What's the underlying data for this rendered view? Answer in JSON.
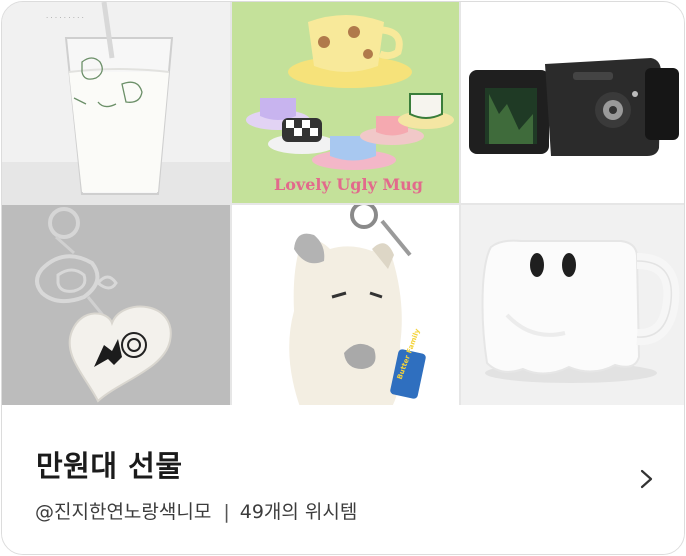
{
  "collection": {
    "title": "만원대 선물",
    "author": "@진지한연노랑색니모",
    "separator": "|",
    "count_text": "49개의 위시템"
  },
  "tiles": [
    {
      "subject": "glass-cup",
      "printed_text": ""
    },
    {
      "subject": "painted-mugs",
      "printed_text": "Lovely Ugly Mug"
    },
    {
      "subject": "video-camera",
      "printed_text": ""
    },
    {
      "subject": "heart-keyring",
      "printed_text": ""
    },
    {
      "subject": "cat-plush-keyring",
      "printed_text": "Butter Family"
    },
    {
      "subject": "ghost-mug",
      "printed_text": ""
    }
  ],
  "icons": {
    "chevron": "chevron-right-icon"
  },
  "colors": {
    "title": "#1b1b1b",
    "meta": "#3c3c3c",
    "mugs_background": "#c4e19a"
  }
}
